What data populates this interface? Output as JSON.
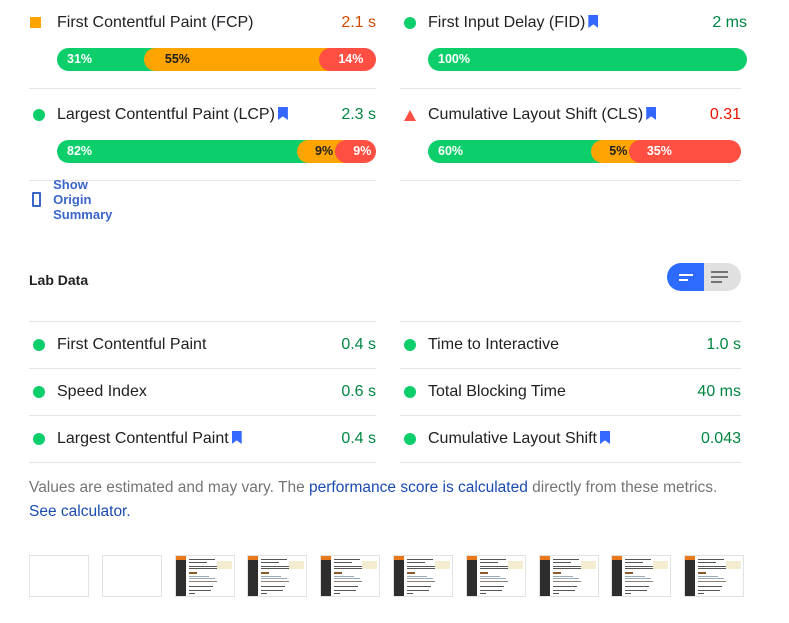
{
  "field_data": {
    "metrics": [
      {
        "id": "fcp",
        "label": "First Contentful Paint (FCP)",
        "indicator": "average-square",
        "core_web_vital": false,
        "value": "2.1 s",
        "rating": "average",
        "distribution": [
          {
            "category": "fast",
            "percent": 31,
            "label": "31%"
          },
          {
            "category": "average",
            "percent": 55,
            "label": "55%"
          },
          {
            "category": "slow",
            "percent": 14,
            "label": "14%"
          }
        ]
      },
      {
        "id": "fid",
        "label": "First Input Delay (FID)",
        "indicator": "pass-circle",
        "core_web_vital": true,
        "value": "2 ms",
        "rating": "good",
        "distribution": [
          {
            "category": "fast",
            "percent": 100,
            "label": "100%"
          }
        ]
      },
      {
        "id": "lcp",
        "label": "Largest Contentful Paint (LCP)",
        "indicator": "pass-circle",
        "core_web_vital": true,
        "value": "2.3 s",
        "rating": "good",
        "distribution": [
          {
            "category": "fast",
            "percent": 82,
            "label": "82%"
          },
          {
            "category": "average",
            "percent": 9,
            "label": "9%"
          },
          {
            "category": "slow",
            "percent": 9,
            "label": "9%"
          }
        ]
      },
      {
        "id": "cls",
        "label": "Cumulative Layout Shift (CLS)",
        "indicator": "fail-triangle",
        "core_web_vital": true,
        "value": "0.31",
        "rating": "poor",
        "distribution": [
          {
            "category": "fast",
            "percent": 60,
            "label": "60%"
          },
          {
            "category": "average",
            "percent": 5,
            "label": "5%"
          },
          {
            "category": "slow",
            "percent": 35,
            "label": "35%"
          }
        ]
      }
    ],
    "origin_summary": {
      "label": "Show Origin Summary",
      "checked": false
    }
  },
  "lab_data": {
    "title": "Lab Data",
    "view_toggle": {
      "options": [
        "compact-view",
        "expanded-view"
      ],
      "selected": "compact-view"
    },
    "metrics": [
      {
        "label": "First Contentful Paint",
        "value": "0.4 s",
        "core_web_vital": false
      },
      {
        "label": "Time to Interactive",
        "value": "1.0 s",
        "core_web_vital": false
      },
      {
        "label": "Speed Index",
        "value": "0.6 s",
        "core_web_vital": false
      },
      {
        "label": "Total Blocking Time",
        "value": "40 ms",
        "core_web_vital": false
      },
      {
        "label": "Largest Contentful Paint",
        "value": "0.4 s",
        "core_web_vital": true
      },
      {
        "label": "Cumulative Layout Shift",
        "value": "0.043",
        "core_web_vital": true
      }
    ],
    "note": {
      "text1": "Values are estimated and may vary. The ",
      "link1": "performance score is calculated",
      "text2": " directly from these metrics. ",
      "link2": "See calculator."
    }
  },
  "filmstrip": {
    "frames": [
      "blank",
      "blank",
      "page",
      "page",
      "page",
      "page",
      "page",
      "page",
      "page",
      "page"
    ]
  },
  "colors": {
    "fast": "#0cce6b",
    "average": "#ffa400",
    "slow": "#ff4e42",
    "good_text": "#018642",
    "average_text": "#d04900",
    "poor_text": "#eb0f00",
    "accent": "#2d6bff",
    "link": "#1a4bb0"
  }
}
